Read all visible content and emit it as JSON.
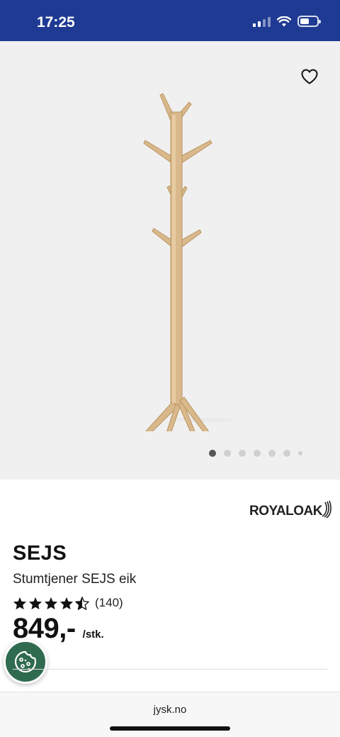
{
  "status_bar": {
    "time": "17:25",
    "bg_color": "#1f3a93"
  },
  "gallery": {
    "image_count": 7,
    "active_index": 0,
    "favorite_icon": "heart-outline-icon"
  },
  "brand": {
    "logo_text_1": "ROYAL",
    "logo_text_2": "OAK",
    "tm": "™"
  },
  "product": {
    "name": "SEJS",
    "subtitle": "Stumtjener SEJS eik",
    "rating": 4.5,
    "rating_count": "(140)",
    "price": "849,-",
    "unit": "/stk."
  },
  "cookie_button": {
    "icon": "cookie-icon",
    "color": "#2f6b4f"
  },
  "browser": {
    "url": "jysk.no"
  }
}
